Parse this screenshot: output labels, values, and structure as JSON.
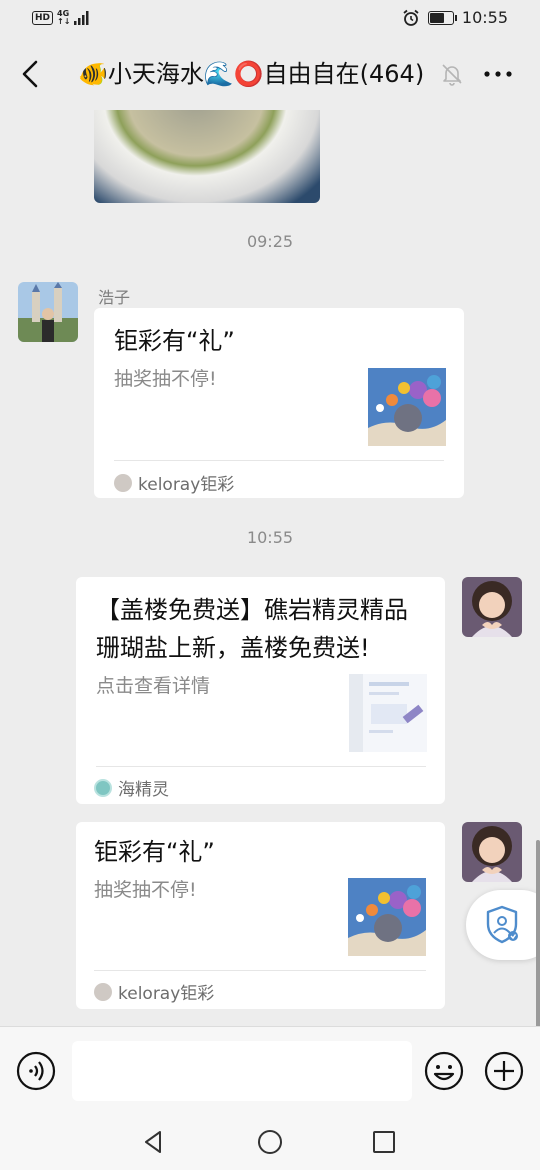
{
  "status": {
    "hd": "HD",
    "net_top": "4G",
    "net_bottom": "↑↓",
    "time": "10:55",
    "battery_level": 0.7
  },
  "header": {
    "title": "🐠小天海水🌊⭕自由自在(464)"
  },
  "messages": {
    "ts1": "09:25",
    "ts2": "10:55",
    "m1": {
      "sender": "浩子",
      "title": "钜彩有“礼”",
      "desc": "抽奖抽不停!",
      "source": "keloray钜彩"
    },
    "m2": {
      "title_line1": "【盖楼免费送】礁岩精灵精品",
      "title_line2": "珊瑚盐上新，盖楼免费送!",
      "desc": "点击查看详情",
      "source": "海精灵"
    },
    "m3": {
      "title": "钜彩有“礼”",
      "desc": "抽奖抽不停!",
      "source": "keloray钜彩"
    }
  },
  "input": {
    "placeholder": ""
  },
  "icons": [
    "back-icon",
    "mute-icon",
    "more-icon",
    "voice-icon",
    "emoji-icon",
    "plus-icon",
    "shield-icon",
    "nav-back-icon",
    "nav-home-icon",
    "nav-recent-icon"
  ],
  "colors": {
    "bg": "#ededed",
    "card": "#ffffff",
    "text": "#111111",
    "muted": "#8a8a8a",
    "accent": "#4e8ccc"
  }
}
